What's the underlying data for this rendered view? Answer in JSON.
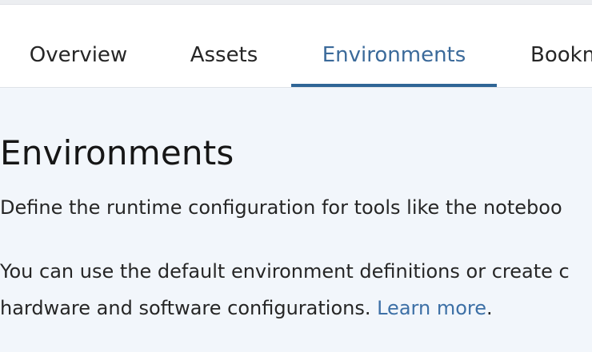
{
  "tabs": [
    {
      "label": "Overview",
      "active": false
    },
    {
      "label": "Assets",
      "active": false
    },
    {
      "label": "Environments",
      "active": true
    },
    {
      "label": "Bookm",
      "active": false
    }
  ],
  "main": {
    "title": "Environments",
    "description": "Define the runtime configuration for tools like the noteboo",
    "info_line_1": "You can use the default environment definitions or create c",
    "info_line_2_prefix": "hardware and software configurations. ",
    "learn_more_label": "Learn more",
    "info_line_2_suffix": "."
  },
  "colors": {
    "active_tab_accent": "#2f6596",
    "link": "#3d70a6",
    "content_background": "#f2f6fb"
  }
}
